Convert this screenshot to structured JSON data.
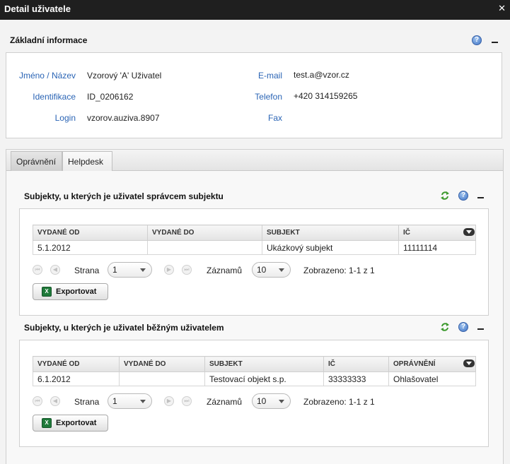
{
  "window": {
    "title": "Detail uživatele",
    "close": "✕"
  },
  "basic": {
    "title": "Základní informace",
    "name_label": "Jméno / Název",
    "name_value": "Vzorový 'A' Uživatel",
    "id_label": "Identifikace",
    "id_value": "ID_0206162",
    "login_label": "Login",
    "login_value": "vzorov.auziva.8907",
    "email_label": "E-mail",
    "email_value": "test.a@vzor.cz",
    "phone_label": "Telefon",
    "phone_value": "+420 314159265",
    "fax_label": "Fax",
    "fax_value": ""
  },
  "tabs": [
    {
      "label": "Oprávnění",
      "active": true
    },
    {
      "label": "Helpdesk",
      "active": false
    }
  ],
  "section1": {
    "title": "Subjekty, u kterých je uživatel správcem subjektu",
    "columns": [
      "VYDANÉ OD",
      "VYDANÉ DO",
      "SUBJEKT",
      "IČ"
    ],
    "rows": [
      [
        "5.1.2012",
        "",
        "Ukázkový subjekt",
        "11111114"
      ]
    ],
    "pager": {
      "page_label": "Strana",
      "page_value": "1",
      "records_label": "Záznamů",
      "records_value": "10",
      "shown": "Zobrazeno: 1-1 z 1"
    },
    "export_label": "Exportovat"
  },
  "section2": {
    "title": "Subjekty, u kterých je uživatel běžným uživatelem",
    "columns": [
      "VYDANÉ OD",
      "VYDANÉ DO",
      "SUBJEKT",
      "IČ",
      "OPRÁVNĚNÍ"
    ],
    "rows": [
      [
        "6.1.2012",
        "",
        "Testovací objekt s.p.",
        "33333333",
        "Ohlašovatel"
      ]
    ],
    "pager": {
      "page_label": "Strana",
      "page_value": "1",
      "records_label": "Záznamů",
      "records_value": "10",
      "shown": "Zobrazeno: 1-1 z 1"
    },
    "export_label": "Exportovat"
  },
  "icons": {
    "help": "?",
    "xls": "X",
    "first": "⏮",
    "prev": "◀",
    "next": "▶",
    "last": "⏭"
  },
  "colors": {
    "label_blue": "#2a64b5",
    "refresh_green": "#3d9a2e",
    "title_bar": "#1f1f1f"
  }
}
